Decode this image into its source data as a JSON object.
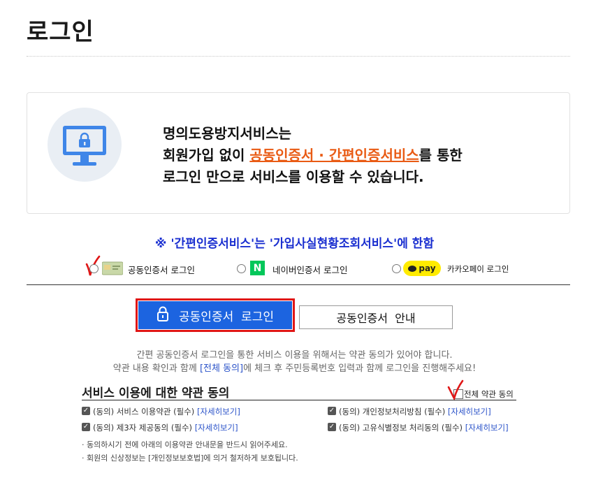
{
  "page": {
    "title": "로그인"
  },
  "info": {
    "line1": "명의도용방지서비스는",
    "line2_prefix": "회원가입 없이 ",
    "line2_highlight": "공동인증서 · 간편인증서비스",
    "line2_suffix": "를 통한",
    "line3": "로그인 만으로 서비스를 이용할 수 있습니다."
  },
  "notice": "※ '간편인증서비스'는 '가입사실현황조회서비스'에 한함",
  "login_methods": [
    {
      "label": "공동인증서 로그인",
      "icon": "certificate-card-icon"
    },
    {
      "label": "네이버인증서 로그인",
      "icon": "naver-n-icon",
      "icon_text": "N"
    },
    {
      "label": "카카오페이 로그인",
      "icon": "kakaopay-icon",
      "icon_text": "pay"
    }
  ],
  "buttons": {
    "login": "공동인증서  로그인",
    "guide": "공동인증서  안내"
  },
  "description": {
    "line1": "간편 공동인증서 로그인을 통한 서비스 이용을 위해서는 약관 동의가 있어야 합니다.",
    "line2_prefix": "약관 내용 확인과 함께 ",
    "line2_link": "[전체 동의]",
    "line2_suffix": "에 체크 후 주민등록번호 입력과 함께 로그인을 진행해주세요!"
  },
  "terms": {
    "title": "서비스 이용에 대한 약관 동의",
    "agree_all": "전체 약관 동의",
    "detail_link": "[자세히보기]",
    "items": [
      {
        "label": "(동의) 서비스 이용약관 (필수)"
      },
      {
        "label": "(동의) 개인정보처리방침 (필수)"
      },
      {
        "label": "(동의) 제3자 제공동의 (필수)"
      },
      {
        "label": "(동의) 고유식별정보 처리동의 (필수)"
      }
    ],
    "notes": [
      "· 동의하시기 전에 아래의 이용약관 안내문을 반드시 읽어주세요.",
      "· 회원의 신상정보는 [개인정보보호법]에 의거 철저하게 보호됩니다."
    ]
  },
  "colors": {
    "accent_blue": "#1c64e0",
    "highlight_orange": "#e95b14",
    "notice_blue": "#1a2fd0",
    "annotation_red": "#e01616"
  }
}
